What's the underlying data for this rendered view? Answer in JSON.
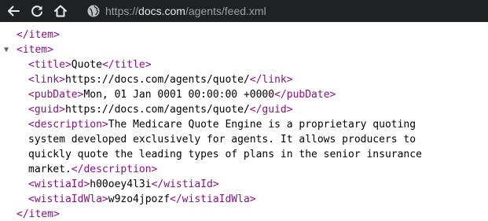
{
  "browser": {
    "url_scheme": "https://",
    "url_host": "docs.com",
    "url_path": "/agents/feed.xml"
  },
  "xml": {
    "prev_item_close": "</item>",
    "item_open": "<item>",
    "title_open": "<title>",
    "title_text": "Quote",
    "title_close": "</title>",
    "link_open": "<link>",
    "link_text": "https://docs.com/agents/quote/",
    "link_close": "</link>",
    "pubdate_open": "<pubDate>",
    "pubdate_text": "Mon, 01 Jan 0001 00:00:00 +0000",
    "pubdate_close": "</pubDate>",
    "guid_open": "<guid>",
    "guid_text": "https://docs.com/agents/quote/",
    "guid_close": "</guid>",
    "description_open": "<description>",
    "description_line1": "The Medicare Quote Engine is a proprietary quoting",
    "description_line2": "system developed exclusively for agents. It allows producers to",
    "description_line3": "quickly quote the leading types of plans in the senior insurance",
    "description_line4": "market.",
    "description_close": "</description>",
    "wistiaid_open": "<wistiaId>",
    "wistiaid_text": "h00oey4l3i",
    "wistiaid_close": "</wistiaId>",
    "wistiaidwla_open": "<wistiaIdWla>",
    "wistiaidwla_text": "w9zo4jpozf",
    "wistiaidwla_close": "</wistiaIdWla>",
    "item_close": "</item>",
    "collapse_arrow": "▼"
  },
  "icons": {
    "back": "back-arrow-icon",
    "reload": "reload-icon",
    "home": "home-icon",
    "site_info": "globe-icon"
  },
  "colors": {
    "toolbar_bg": "#202124",
    "tag": "#881280",
    "text": "#000000"
  }
}
